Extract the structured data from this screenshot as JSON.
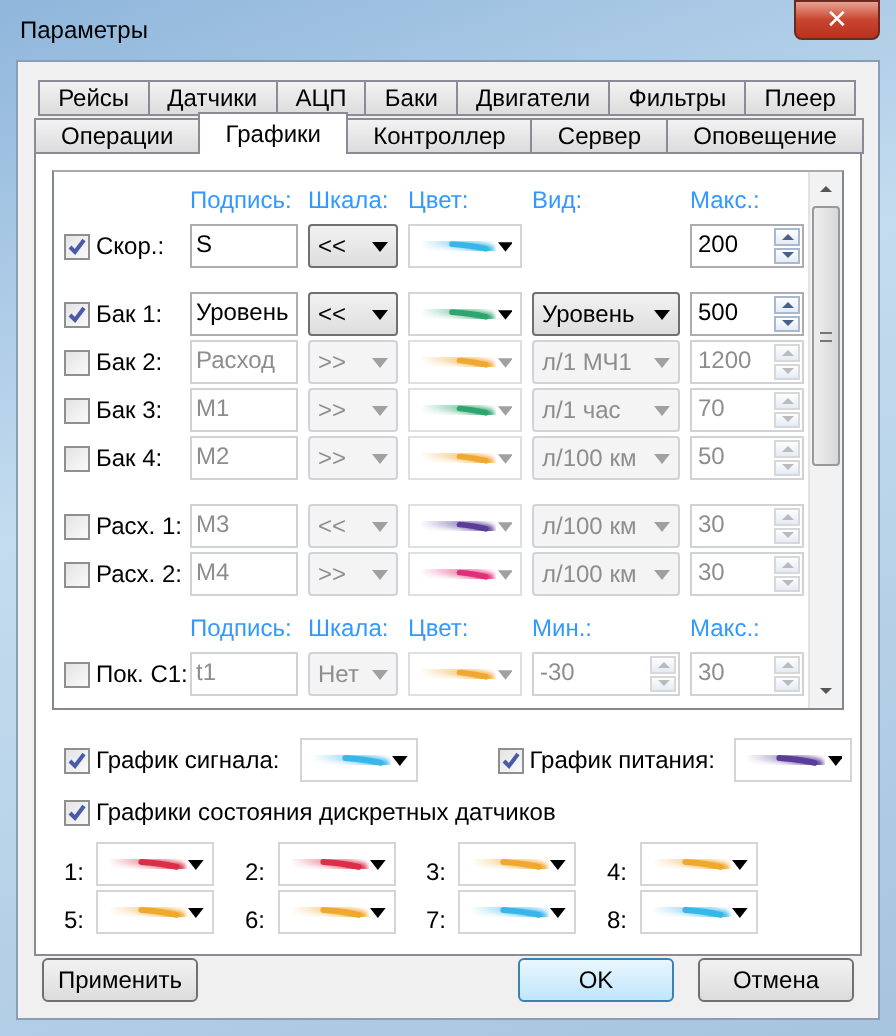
{
  "window": {
    "title": "Параметры",
    "close": "✕"
  },
  "tab_rows": [
    [
      {
        "label": "Рейсы",
        "selected": false
      },
      {
        "label": "Датчики",
        "selected": false
      },
      {
        "label": "АЦП",
        "selected": false
      },
      {
        "label": "Баки",
        "selected": false
      },
      {
        "label": "Двигатели",
        "selected": false
      },
      {
        "label": "Фильтры",
        "selected": false
      },
      {
        "label": "Плеер",
        "selected": false
      }
    ],
    [
      {
        "label": "Операции",
        "selected": false
      },
      {
        "label": "Графики",
        "selected": true
      },
      {
        "label": "Контроллер",
        "selected": false
      },
      {
        "label": "Сервер",
        "selected": false
      },
      {
        "label": "Оповещение",
        "selected": false
      }
    ]
  ],
  "groups": [
    {
      "headers": [
        "Подпись:",
        "Шкала:",
        "Цвет:",
        "Вид:",
        "Макс.:"
      ],
      "blocks": [
        [
          {
            "label": "Скор.:",
            "checked": true,
            "caption": "S",
            "scale": "<<",
            "color": "#38b6ea",
            "max": "200"
          }
        ],
        [
          {
            "label": "Бак 1:",
            "checked": true,
            "caption": "Уровень",
            "scale": "<<",
            "color": "#2ea46e",
            "view": "Уровень",
            "max": "500"
          },
          {
            "label": "Бак 2:",
            "checked": false,
            "caption": "Расход",
            "scale": ">>",
            "color": "#f0a830",
            "view": "л/1 МЧ1",
            "max": "1200"
          },
          {
            "label": "Бак 3:",
            "checked": false,
            "caption": "М1",
            "scale": ">>",
            "color": "#2ea46e",
            "view": "л/1 час",
            "max": "70"
          },
          {
            "label": "Бак 4:",
            "checked": false,
            "caption": "М2",
            "scale": ">>",
            "color": "#f0a830",
            "view": "л/100 км",
            "max": "50"
          }
        ],
        [
          {
            "label": "Расх. 1:",
            "checked": false,
            "caption": "М3",
            "scale": "<<",
            "color": "#5a3d99",
            "view": "л/100 км",
            "max": "30"
          },
          {
            "label": "Расх. 2:",
            "checked": false,
            "caption": "М4",
            "scale": ">>",
            "color": "#e0307a",
            "view": "л/100 км",
            "max": "30"
          }
        ]
      ]
    },
    {
      "headers": [
        "Подпись:",
        "Шкала:",
        "Цвет:",
        "Мин.:",
        "Макс.:"
      ],
      "blocks": [
        [
          {
            "label": "Пок. С1:",
            "checked": false,
            "caption": "t1",
            "scale": "Нет",
            "color": "#f0a830",
            "min": "-30",
            "max": "30"
          }
        ]
      ]
    }
  ],
  "charts": [
    {
      "label": "График сигнала:",
      "checked": true,
      "color": "#38b6ea"
    },
    {
      "label": "График питания:",
      "checked": true,
      "color": "#5a3d99"
    }
  ],
  "discrete": {
    "label": "Графики состояния дискретных датчиков",
    "checked": true,
    "sensors": [
      {
        "label": "1:",
        "color": "#d9304a"
      },
      {
        "label": "2:",
        "color": "#d9304a"
      },
      {
        "label": "3:",
        "color": "#f0a830"
      },
      {
        "label": "4:",
        "color": "#f0a830"
      },
      {
        "label": "5:",
        "color": "#f0a830"
      },
      {
        "label": "6:",
        "color": "#f0a830"
      },
      {
        "label": "7:",
        "color": "#38b6ea"
      },
      {
        "label": "8:",
        "color": "#38b6ea"
      }
    ]
  },
  "buttons": [
    {
      "label": "Применить",
      "default": false
    },
    {
      "label": "OK",
      "default": true
    },
    {
      "label": "Отмена",
      "default": false
    }
  ]
}
